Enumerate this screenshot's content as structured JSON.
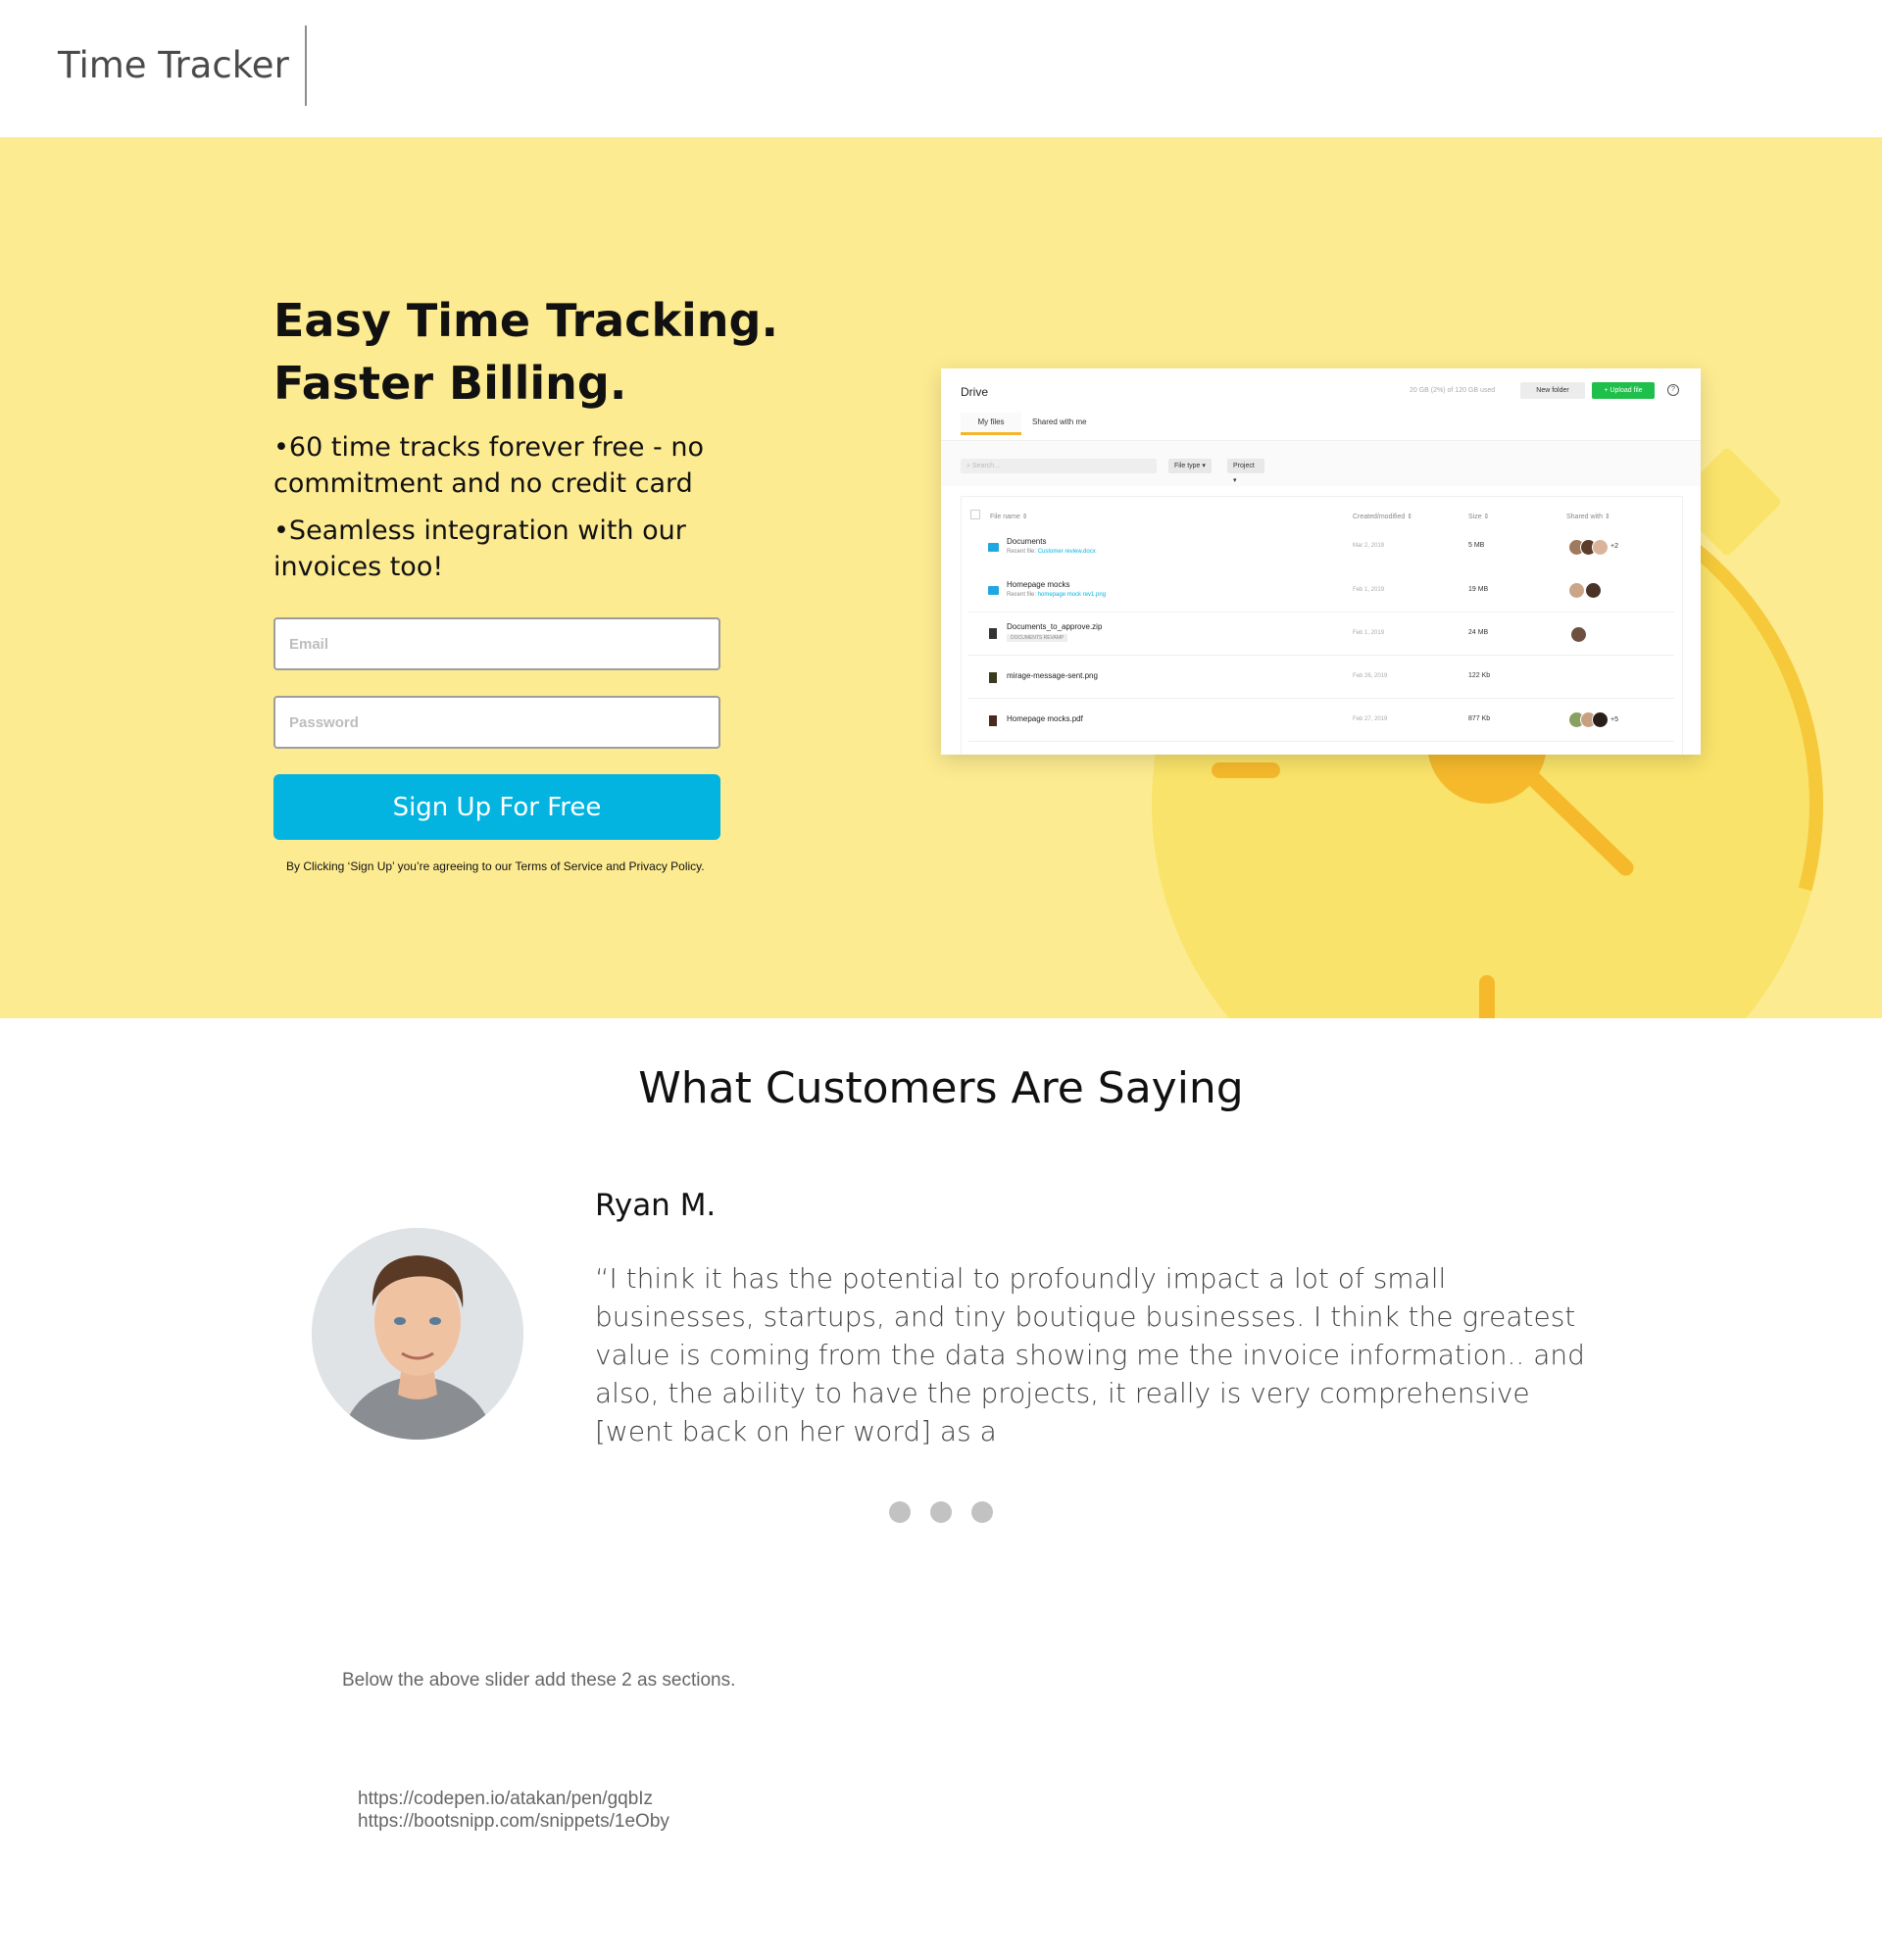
{
  "header": {
    "brand": "Time Tracker"
  },
  "hero": {
    "headline_1": "Easy Time Tracking.",
    "headline_2": "Faster Billing.",
    "bullet_1": "•60 time tracks forever free - no commitment and no credit card",
    "bullet_2": "•Seamless integration with our invoices too!",
    "email_placeholder": "Email",
    "password_placeholder": "Password",
    "signup_label": "Sign Up For Free",
    "legal_text": "By Clicking ‘Sign Up’ you’re agreeing to our Terms of Service and Privacy Policy."
  },
  "mock_drive": {
    "title": "Drive",
    "usage": "20 GB (2%) of 120 GB used",
    "new_folder": "New folder",
    "upload": "+ Upload file",
    "help": "?",
    "tabs": [
      "My files",
      "Shared with me"
    ],
    "search_placeholder": "Search...",
    "filters": [
      "File type ▾",
      "Project ▾"
    ],
    "columns": [
      "File name ⇕",
      "Created/modified ⇕",
      "Size ⇕",
      "Shared with ⇕"
    ],
    "rows": [
      {
        "name": "Documents",
        "sub_prefix": "Recent file:",
        "sub_file": "Customer review.docx",
        "date": "Mar 2, 2019",
        "size": "5 MB",
        "more": "+2"
      },
      {
        "name": "Homepage mocks",
        "sub_prefix": "Recent file:",
        "sub_file": "homepage mock rev1.png",
        "date": "Feb 1, 2019",
        "size": "19 MB",
        "more": ""
      },
      {
        "name": "Documents_to_approve.zip",
        "badge": "DOCUMENTS REVAMP",
        "date": "Feb 1, 2019",
        "size": "24 MB",
        "more": ""
      },
      {
        "name": "mirage-message-sent.png",
        "date": "Feb 26, 2019",
        "size": "122 Kb",
        "more": ""
      },
      {
        "name": "Homepage mocks.pdf",
        "date": "Feb 27, 2019",
        "size": "877 Kb",
        "more": "+5"
      }
    ]
  },
  "testimonials": {
    "title": "What Customers Are Saying",
    "name": "Ryan M.",
    "quote": "“I think it has the potential to profoundly impact a lot of small businesses, startups, and tiny boutique businesses. I think the greatest value is coming from the data showing me the invoice information.. and also, the ability to have the projects, it really is very comprehensive [went back on her word] as a",
    "slides": 3
  },
  "notes": {
    "text": "Below the above slider add these 2 as sections.",
    "link_1": "https://codepen.io/atakan/pen/gqbIz",
    "link_2": "https://bootsnipp.com/snippets/1eOby"
  },
  "colors": {
    "hero_bg": "#fdeb91",
    "cta": "#03b4e0",
    "upload_green": "#1fbf4b",
    "clock_yellow": "#f9e36a",
    "clock_orange": "#f6b92c"
  }
}
